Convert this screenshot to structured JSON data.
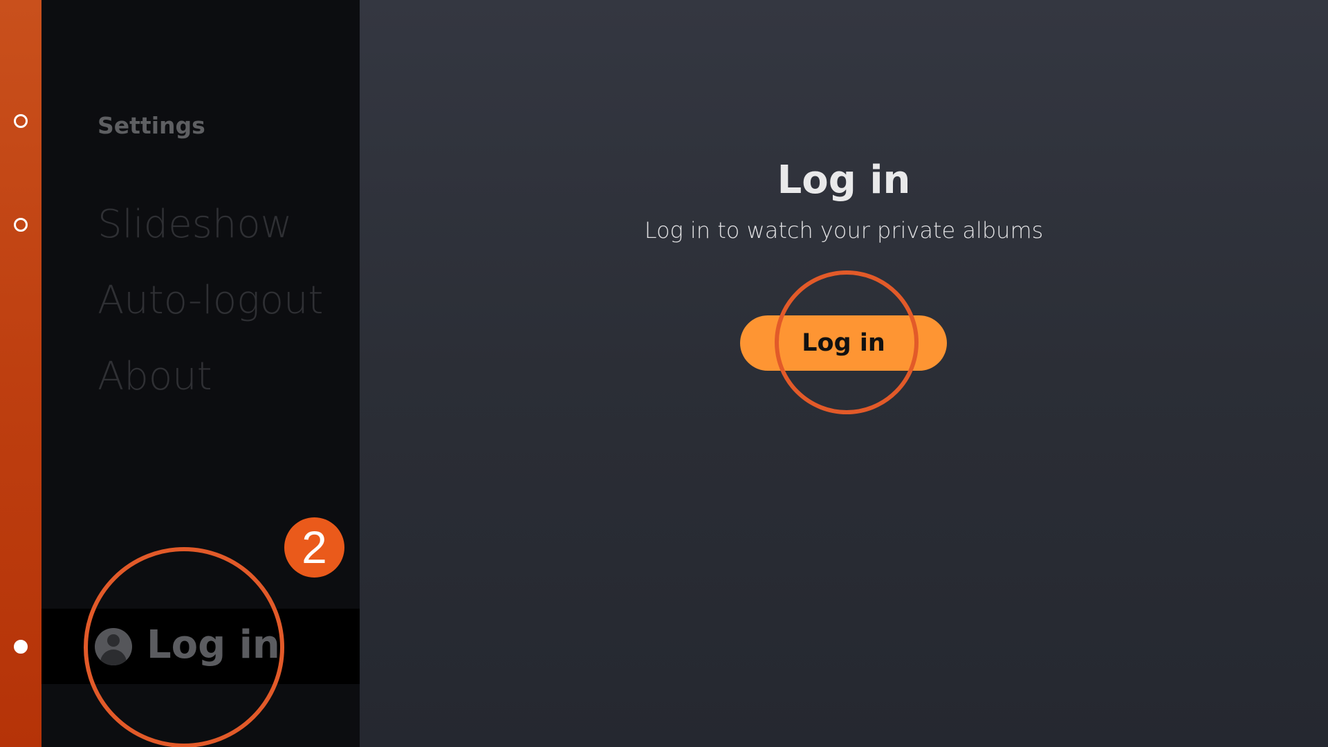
{
  "colors": {
    "rail_accent": "#c24410",
    "button_fill": "#fe9533",
    "annotation": "#e25a29",
    "badge": "#ea5a1b"
  },
  "rail": {
    "dots": [
      {
        "state": "hollow"
      },
      {
        "state": "hollow"
      },
      {
        "state": "filled"
      }
    ]
  },
  "sidebar": {
    "title": "Settings",
    "items": [
      {
        "label": "Slideshow"
      },
      {
        "label": "Auto-logout"
      },
      {
        "label": "About"
      }
    ],
    "login": {
      "icon": "user-avatar-icon",
      "label": "Log in"
    }
  },
  "main": {
    "title": "Log in",
    "subtitle": "Log in to watch your private albums",
    "button_label": "Log in"
  },
  "annotations": {
    "step_number": "2"
  }
}
